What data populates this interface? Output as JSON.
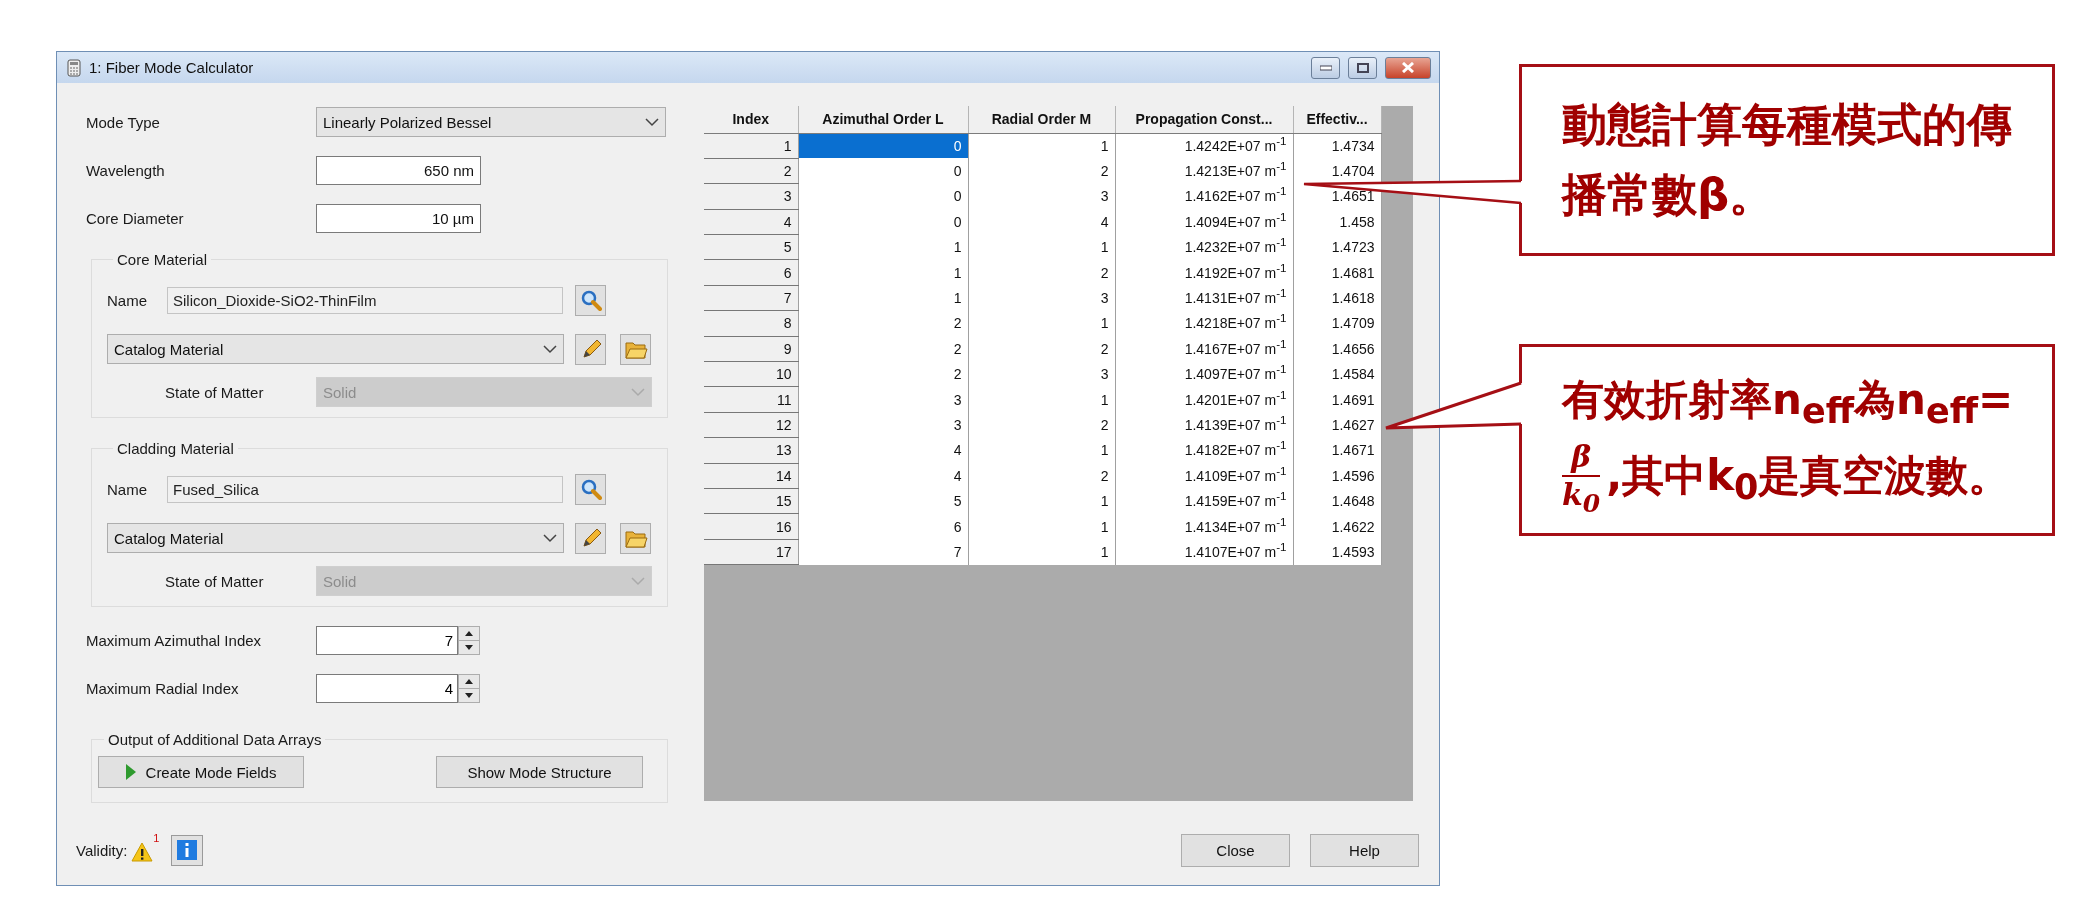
{
  "window": {
    "title": "1: Fiber Mode Calculator"
  },
  "settings": [
    {
      "label": "Mode Type",
      "kind": "dropdown",
      "value": "Linearly Polarized Bessel"
    },
    {
      "label": "Wavelength",
      "kind": "text",
      "value": "650 nm"
    },
    {
      "label": "Core Diameter",
      "kind": "text",
      "value": "10 µm"
    }
  ],
  "materials": [
    {
      "title": "Core Material",
      "name_label": "Name",
      "name": "Silicon_Dioxide-SiO2-ThinFilm",
      "source": "Catalog Material",
      "state_label": "State of Matter",
      "state": "Solid",
      "state_disabled": true
    },
    {
      "title": "Cladding Material",
      "name_label": "Name",
      "name": "Fused_Silica",
      "source": "Catalog Material",
      "state_label": "State of Matter",
      "state": "Solid",
      "state_disabled": true
    }
  ],
  "indices": [
    {
      "label": "Maximum Azimuthal Index",
      "value": "7"
    },
    {
      "label": "Maximum Radial Index",
      "value": "4"
    }
  ],
  "output": {
    "title": "Output of Additional Data Arrays",
    "buttons": [
      {
        "label": "Create Mode Fields",
        "kind": "run"
      },
      {
        "label": "Show Mode Structure",
        "kind": "plain"
      }
    ]
  },
  "validity": {
    "label": "Validity:",
    "warning_count": "1"
  },
  "table": {
    "columns": [
      "Index",
      "Azimuthal Order L",
      "Radial Order M",
      "Propagation Const...",
      "Effectiv..."
    ],
    "rows": [
      {
        "cells": [
          "1",
          "0",
          "1",
          "1.4242E+07 m$^{-1}$",
          "1.4734"
        ],
        "selected": true
      },
      {
        "cells": [
          "2",
          "0",
          "2",
          "1.4213E+07 m$^{-1}$",
          "1.4704"
        ],
        "selected": false
      },
      {
        "cells": [
          "3",
          "0",
          "3",
          "1.4162E+07 m$^{-1}$",
          "1.4651"
        ],
        "selected": false
      },
      {
        "cells": [
          "4",
          "0",
          "4",
          "1.4094E+07 m$^{-1}$",
          "1.458"
        ],
        "selected": false
      },
      {
        "cells": [
          "5",
          "1",
          "1",
          "1.4232E+07 m$^{-1}$",
          "1.4723"
        ],
        "selected": false
      },
      {
        "cells": [
          "6",
          "1",
          "2",
          "1.4192E+07 m$^{-1}$",
          "1.4681"
        ],
        "selected": false
      },
      {
        "cells": [
          "7",
          "1",
          "3",
          "1.4131E+07 m$^{-1}$",
          "1.4618"
        ],
        "selected": false
      },
      {
        "cells": [
          "8",
          "2",
          "1",
          "1.4218E+07 m$^{-1}$",
          "1.4709"
        ],
        "selected": false
      },
      {
        "cells": [
          "9",
          "2",
          "2",
          "1.4167E+07 m$^{-1}$",
          "1.4656"
        ],
        "selected": false
      },
      {
        "cells": [
          "10",
          "2",
          "3",
          "1.4097E+07 m$^{-1}$",
          "1.4584"
        ],
        "selected": false
      },
      {
        "cells": [
          "11",
          "3",
          "1",
          "1.4201E+07 m$^{-1}$",
          "1.4691"
        ],
        "selected": false
      },
      {
        "cells": [
          "12",
          "3",
          "2",
          "1.4139E+07 m$^{-1}$",
          "1.4627"
        ],
        "selected": false
      },
      {
        "cells": [
          "13",
          "4",
          "1",
          "1.4182E+07 m$^{-1}$",
          "1.4671"
        ],
        "selected": false
      },
      {
        "cells": [
          "14",
          "4",
          "2",
          "1.4109E+07 m$^{-1}$",
          "1.4596"
        ],
        "selected": false
      },
      {
        "cells": [
          "15",
          "5",
          "1",
          "1.4159E+07 m$^{-1}$",
          "1.4648"
        ],
        "selected": false
      },
      {
        "cells": [
          "16",
          "6",
          "1",
          "1.4134E+07 m$^{-1}$",
          "1.4622"
        ],
        "selected": false
      },
      {
        "cells": [
          "17",
          "7",
          "1",
          "1.4107E+07 m$^{-1}$",
          "1.4593"
        ],
        "selected": false
      }
    ]
  },
  "buttons": [
    {
      "label": "Close"
    },
    {
      "label": "Help"
    }
  ],
  "callouts": [
    {
      "kind": "text",
      "text": "動態計算每種模式的傳播常數β。"
    },
    {
      "kind": "formula",
      "lead": "有效折射率n$_{eff}$為n$_{eff}$=",
      "fraction": {
        "numerator": "β",
        "denominator": "k$_{0}$"
      },
      "tail": ",其中k$_{0}$是真空波數。"
    }
  ]
}
